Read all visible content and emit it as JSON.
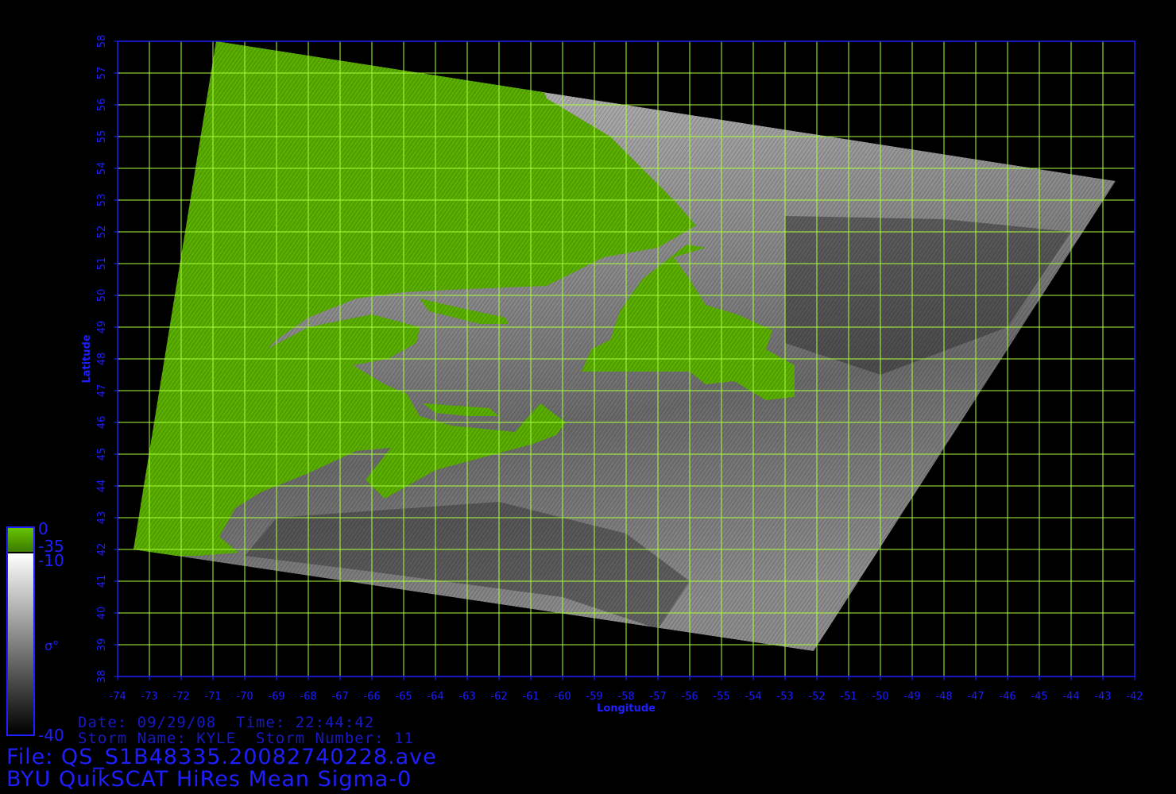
{
  "colors": {
    "background": "#000000",
    "grid": "#a8ff3c",
    "axis": "#1e1eff",
    "land": "#5aae00",
    "ocean_light": "#b8b8b8",
    "ocean_dark": "#3a3a3a"
  },
  "chart_data": {
    "type": "heatmap",
    "title": "BYU QuikSCAT HiRes Mean Sigma-0",
    "xlabel": "Longitude",
    "ylabel": "Latitude",
    "xlim": [
      -74,
      -42
    ],
    "ylim": [
      38,
      58
    ],
    "x_ticks": [
      "-74",
      "-73",
      "-72",
      "-71",
      "-70",
      "-69",
      "-68",
      "-67",
      "-66",
      "-65",
      "-64",
      "-63",
      "-62",
      "-61",
      "-60",
      "-59",
      "-58",
      "-57",
      "-56",
      "-55",
      "-54",
      "-53",
      "-52",
      "-51",
      "-50",
      "-49",
      "-48",
      "-47",
      "-46",
      "-45",
      "-44",
      "-43",
      "-42"
    ],
    "y_ticks": [
      "38",
      "39",
      "40",
      "41",
      "42",
      "43",
      "44",
      "45",
      "46",
      "47",
      "48",
      "49",
      "50",
      "51",
      "52",
      "53",
      "54",
      "55",
      "56",
      "57",
      "58"
    ],
    "grid": true,
    "swath_corners": [
      [
        -70.9,
        58.0
      ],
      [
        -42.6,
        53.6
      ],
      [
        -52.1,
        38.8
      ],
      [
        -73.5,
        42.0
      ]
    ],
    "colorbar": {
      "label": "σ°",
      "ticks": [
        "0",
        "-35",
        "-10",
        "-40"
      ],
      "land_range": [
        -35,
        0
      ],
      "ocean_range": [
        -40,
        -10
      ],
      "placement": "left-bottom"
    }
  },
  "info": {
    "date_line": "Date: 09/29/08  Time: 22:44:42",
    "storm_line": "Storm Name: KYLE  Storm Number: 11",
    "file_line": "File: QS_S1B48335.20082740228.ave",
    "title_line": "BYU QuikSCAT HiRes Mean Sigma-0"
  }
}
